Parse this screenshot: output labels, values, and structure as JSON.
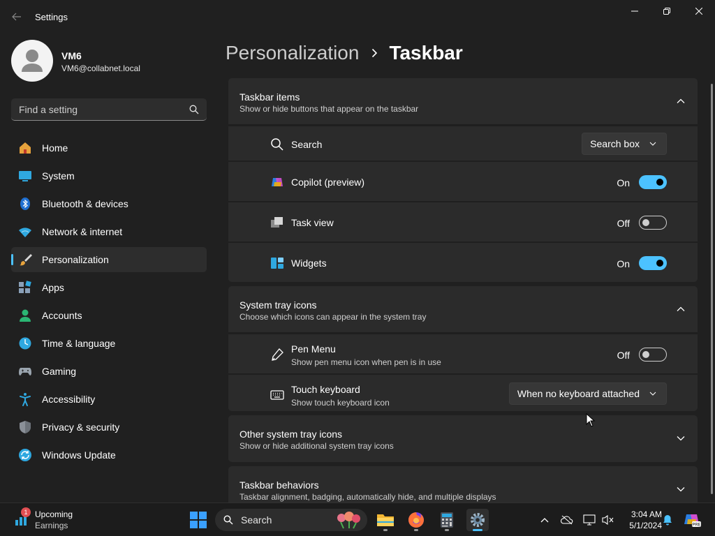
{
  "window": {
    "title": "Settings"
  },
  "profile": {
    "name": "VM6",
    "email": "VM6@collabnet.local"
  },
  "search": {
    "placeholder": "Find a setting"
  },
  "sidebar": {
    "items": [
      {
        "label": "Home",
        "icon": "home-icon",
        "selected": false
      },
      {
        "label": "System",
        "icon": "system-icon",
        "selected": false
      },
      {
        "label": "Bluetooth & devices",
        "icon": "bluetooth-icon",
        "selected": false
      },
      {
        "label": "Network & internet",
        "icon": "wifi-icon",
        "selected": false
      },
      {
        "label": "Personalization",
        "icon": "brush-icon",
        "selected": true
      },
      {
        "label": "Apps",
        "icon": "apps-icon",
        "selected": false
      },
      {
        "label": "Accounts",
        "icon": "accounts-icon",
        "selected": false
      },
      {
        "label": "Time & language",
        "icon": "clock-globe-icon",
        "selected": false
      },
      {
        "label": "Gaming",
        "icon": "gamepad-icon",
        "selected": false
      },
      {
        "label": "Accessibility",
        "icon": "accessibility-icon",
        "selected": false
      },
      {
        "label": "Privacy & security",
        "icon": "shield-icon",
        "selected": false
      },
      {
        "label": "Windows Update",
        "icon": "update-icon",
        "selected": false
      }
    ]
  },
  "breadcrumb": {
    "parent": "Personalization",
    "current": "Taskbar"
  },
  "sections": {
    "taskbar_items": {
      "title": "Taskbar items",
      "subtitle": "Show or hide buttons that appear on the taskbar",
      "expanded": true,
      "rows": {
        "search": {
          "label": "Search",
          "value": "Search box"
        },
        "copilot": {
          "label": "Copilot (preview)",
          "state": "On",
          "on": true
        },
        "task_view": {
          "label": "Task view",
          "state": "Off",
          "on": false
        },
        "widgets": {
          "label": "Widgets",
          "state": "On",
          "on": true
        }
      }
    },
    "system_tray": {
      "title": "System tray icons",
      "subtitle": "Choose which icons can appear in the system tray",
      "expanded": true,
      "rows": {
        "pen_menu": {
          "label": "Pen Menu",
          "sublabel": "Show pen menu icon when pen is in use",
          "state": "Off",
          "on": false
        },
        "touch_keyboard": {
          "label": "Touch keyboard",
          "sublabel": "Show touch keyboard icon",
          "value": "When no keyboard attached"
        }
      }
    },
    "other_tray": {
      "title": "Other system tray icons",
      "subtitle": "Show or hide additional system tray icons",
      "expanded": false
    },
    "behaviors": {
      "title": "Taskbar behaviors",
      "subtitle": "Taskbar alignment, badging, automatically hide, and multiple displays",
      "expanded": false
    }
  },
  "taskbar": {
    "widget": {
      "title": "Upcoming",
      "subtitle": "Earnings",
      "badge": "1"
    },
    "search_label": "Search",
    "apps": [
      "start-icon",
      "file-explorer-icon",
      "firefox-icon",
      "calculator-icon",
      "settings-icon"
    ],
    "clock": {
      "time": "3:04 AM",
      "date": "5/1/2024"
    }
  },
  "colors": {
    "accent": "#4cc2ff",
    "background": "#202020",
    "card": "#2b2b2b"
  }
}
